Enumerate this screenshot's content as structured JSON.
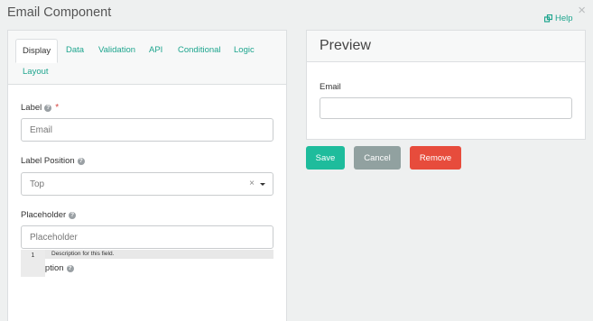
{
  "modal": {
    "title": "Email Component",
    "help_label": "Help",
    "close_glyph": "×"
  },
  "tabs": [
    "Display",
    "Data",
    "Validation",
    "API",
    "Conditional",
    "Logic",
    "Layout"
  ],
  "form": {
    "label_field": {
      "label": "Label",
      "value": "Email",
      "required_mark": "*"
    },
    "label_position": {
      "label": "Label Position",
      "value": "Top",
      "clear_glyph": "×"
    },
    "placeholder_field": {
      "label": "Placeholder",
      "placeholder": "Placeholder"
    },
    "description": {
      "label": "Description",
      "line_number": "1",
      "text": "Description for this field."
    }
  },
  "preview": {
    "title": "Preview",
    "field_label": "Email"
  },
  "buttons": {
    "save": "Save",
    "cancel": "Cancel",
    "remove": "Remove"
  },
  "colors": {
    "accent": "#1ea58e",
    "save": "#1ebc9c",
    "cancel": "#91a1a0",
    "remove": "#e74c3c"
  },
  "icons": {
    "help": "external-link-icon",
    "question": "question-circle-icon"
  }
}
